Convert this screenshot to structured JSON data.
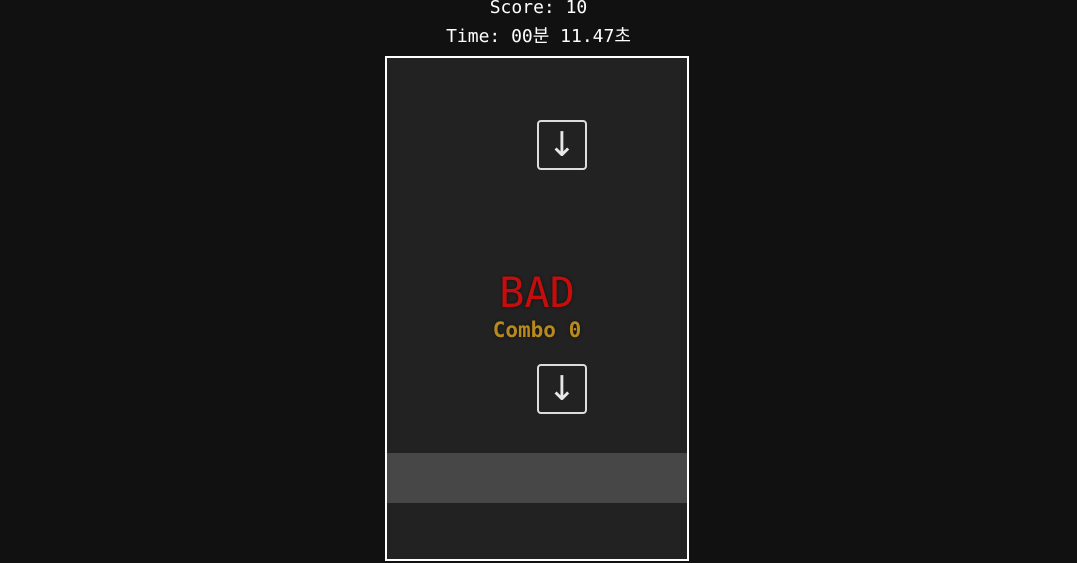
{
  "hud": {
    "score_text": "Score: 10",
    "time_text": "Time: 00분 11.47초"
  },
  "notes": [
    {
      "arrow": "↓",
      "icon": "down-arrow-icon"
    },
    {
      "arrow": "↓",
      "icon": "down-arrow-icon"
    }
  ],
  "judgement": {
    "text": "BAD",
    "color": "#c40e0e"
  },
  "combo": {
    "text": "Combo 0",
    "color": "#b8891e"
  },
  "colors": {
    "page_background": "#111111",
    "board_background": "#222222",
    "board_border": "#ffffff",
    "hit_zone": "#474747"
  }
}
